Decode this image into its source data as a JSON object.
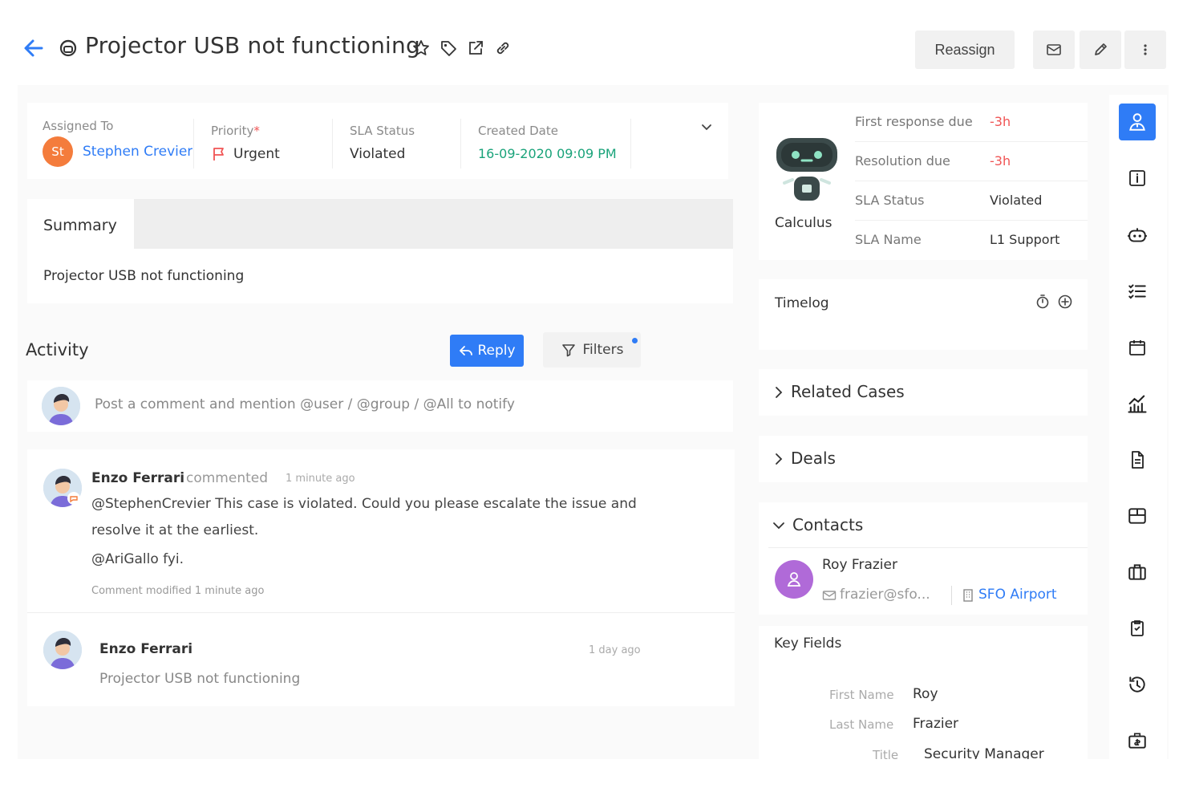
{
  "header": {
    "title": "Projector USB not functioning",
    "reassign_label": "Reassign"
  },
  "fields": {
    "assigned_to_label": "Assigned To",
    "assignee_initials": "St",
    "assignee_name": "Stephen Crevier",
    "priority_label": "Priority",
    "priority_required_mark": "*",
    "priority_value": "Urgent",
    "sla_status_label": "SLA Status",
    "sla_status_value": "Violated",
    "created_date_label": "Created Date",
    "created_date_value": "16-09-2020 09:09 PM"
  },
  "summary": {
    "tab_label": "Summary",
    "text": "Projector USB not functioning"
  },
  "activity": {
    "title": "Activity",
    "reply_label": "Reply",
    "filters_label": "Filters",
    "comment_placeholder": "Post a comment and mention @user / @group / @All to notify",
    "items": [
      {
        "author": "Enzo Ferrari",
        "action": "commented",
        "time": "1 minute ago",
        "line1": "@StephenCrevier This case is violated. Could you please escalate the issue and",
        "line2": "resolve it at the earliest.",
        "line3": "@AriGallo fyi.",
        "footer": "Comment modified 1 minute ago"
      },
      {
        "author": "Enzo Ferrari",
        "time": "1 day ago",
        "text": "Projector USB not functioning"
      }
    ]
  },
  "sla_panel": {
    "bot_name": "Calculus",
    "rows": [
      {
        "key": "First response due",
        "value": "-3h"
      },
      {
        "key": "Resolution due",
        "value": "-3h"
      },
      {
        "key": "SLA Status",
        "value": "Violated"
      },
      {
        "key": "SLA Name",
        "value": "L1 Support"
      }
    ]
  },
  "timelog": {
    "title": "Timelog"
  },
  "related_cases": {
    "title": "Related Cases"
  },
  "deals": {
    "title": "Deals"
  },
  "contacts": {
    "title": "Contacts",
    "name": "Roy Frazier",
    "email": "frazier@sfo...",
    "company": "SFO Airport"
  },
  "key_fields": {
    "title": "Key Fields",
    "rows": [
      {
        "key": "First Name",
        "value": "Roy"
      },
      {
        "key": "Last Name",
        "value": "Frazier"
      },
      {
        "key": "Title",
        "value": "Security Manager"
      }
    ]
  },
  "colors": {
    "accent": "#2f7cf6",
    "danger": "#f05454",
    "created_date": "#1aa37a",
    "assignee_avatar": "#f47c3c",
    "contact_avatar": "#b06ad8"
  },
  "rail_icons": [
    "agent-icon",
    "info-icon",
    "bot-icon",
    "checklist-icon",
    "calendar-icon",
    "analytics-icon",
    "document-icon",
    "box-icon",
    "briefcase-icon",
    "clipboard-icon",
    "history-icon",
    "billing-icon"
  ]
}
